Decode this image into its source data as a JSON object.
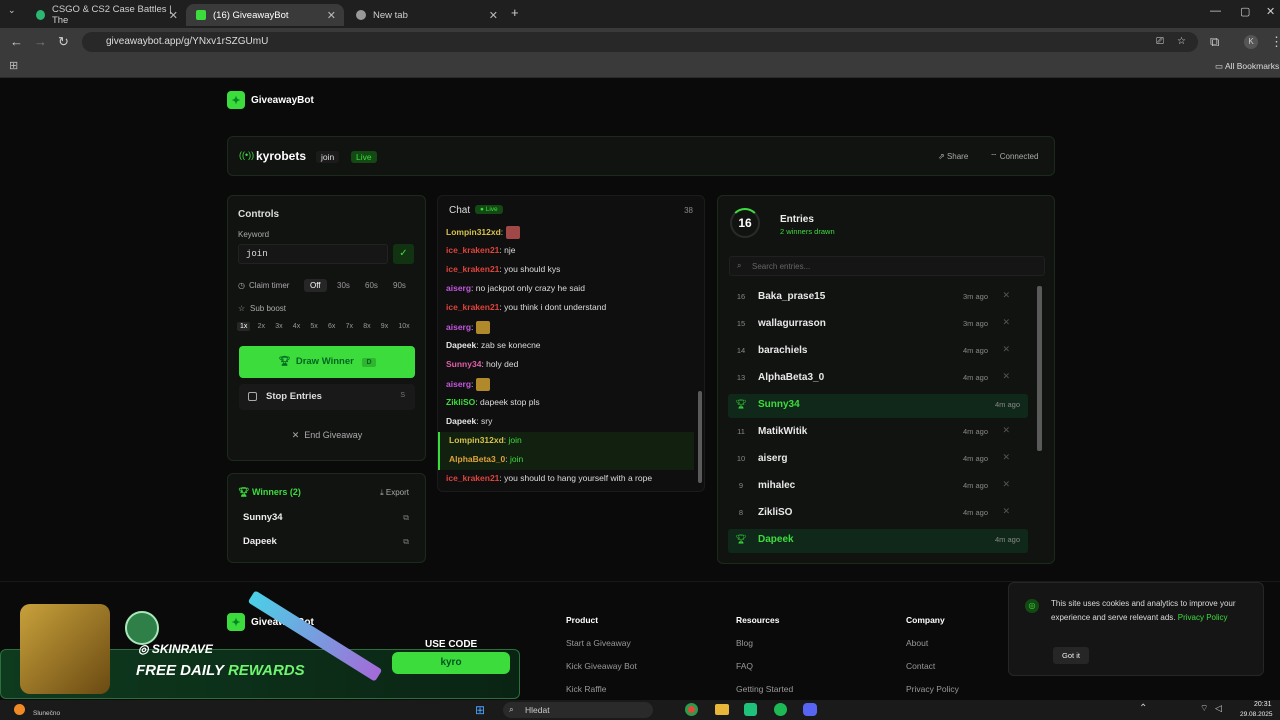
{
  "browser": {
    "tabs": [
      {
        "title": "CSGO & CS2 Case Battles | The"
      },
      {
        "title": "(16) GiveawayBot"
      },
      {
        "title": "New tab"
      }
    ],
    "url": "giveawaybot.app/g/YNxv1rSZGUmU",
    "bookmarks_label": "All Bookmarks",
    "profile_initial": "K"
  },
  "site": {
    "logo": "GiveawayBot"
  },
  "header": {
    "channel": "kyrobets",
    "keyword_badge": "join",
    "live_badge": "Live",
    "share": "Share",
    "connected": "Connected"
  },
  "controls": {
    "title": "Controls",
    "keyword_label": "Keyword",
    "keyword_value": "join",
    "claim_timer_label": "Claim timer",
    "claim_options": [
      "Off",
      "30s",
      "60s",
      "90s"
    ],
    "sub_boost_label": "Sub boost",
    "boost_options": [
      "1x",
      "2x",
      "3x",
      "4x",
      "5x",
      "6x",
      "7x",
      "8x",
      "9x",
      "10x"
    ],
    "draw_button": "Draw Winner",
    "draw_shortcut": "D",
    "stop_entries": "Stop Entries",
    "stop_shortcut": "S",
    "end_giveaway": "End Giveaway"
  },
  "winners": {
    "title": "Winners (2)",
    "export": "Export",
    "list": [
      "Sunny34",
      "Dapeek"
    ]
  },
  "chat": {
    "title": "Chat",
    "live": "Live",
    "count": "38",
    "messages": [
      {
        "user": "Lompin312xd",
        "text": "",
        "color": "#d4c24a",
        "join": false
      },
      {
        "user": "ice_kraken21",
        "text": "nje",
        "color": "#e0443b",
        "join": false
      },
      {
        "user": "ice_kraken21",
        "text": "you should kys",
        "color": "#e0443b",
        "join": false
      },
      {
        "user": "aiserg",
        "text": "no jackpot only crazy he said",
        "color": "#c457e0",
        "join": false
      },
      {
        "user": "ice_kraken21",
        "text": "you think i dont understand",
        "color": "#e0443b",
        "join": false
      },
      {
        "user": "aiserg",
        "text": "",
        "color": "#c457e0",
        "join": false
      },
      {
        "user": "Dapeek",
        "text": "zab se konecne",
        "color": "#e6e6e6",
        "join": false
      },
      {
        "user": "Sunny34",
        "text": "holy ded",
        "color": "#e05fa8",
        "join": false
      },
      {
        "user": "aiserg",
        "text": "",
        "color": "#c457e0",
        "join": false
      },
      {
        "user": "ZikliSO",
        "text": "dapeek stop pls",
        "color": "#3ddc3d",
        "join": false
      },
      {
        "user": "Dapeek",
        "text": "sry",
        "color": "#e6e6e6",
        "join": false
      },
      {
        "user": "Lompin312xd",
        "text": "join",
        "color": "#d4c24a",
        "join": true
      },
      {
        "user": "AlphaBeta3_0",
        "text": "join",
        "color": "#e0a23b",
        "join": true
      },
      {
        "user": "ice_kraken21",
        "text": "you should to hang yourself with a rope",
        "color": "#e0443b",
        "join": false
      }
    ]
  },
  "entries": {
    "count": "16",
    "title": "Entries",
    "subtitle": "2 winners drawn",
    "search_placeholder": "Search entries...",
    "list": [
      {
        "n": "16",
        "name": "Baka_prase15",
        "time": "3m ago",
        "winner": false
      },
      {
        "n": "15",
        "name": "wallagurrason",
        "time": "3m ago",
        "winner": false
      },
      {
        "n": "14",
        "name": "barachiels",
        "time": "4m ago",
        "winner": false
      },
      {
        "n": "13",
        "name": "AlphaBeta3_0",
        "time": "4m ago",
        "winner": false
      },
      {
        "n": "",
        "name": "Sunny34",
        "time": "4m ago",
        "winner": true
      },
      {
        "n": "11",
        "name": "MatikWitik",
        "time": "4m ago",
        "winner": false
      },
      {
        "n": "10",
        "name": "aiserg",
        "time": "4m ago",
        "winner": false
      },
      {
        "n": "9",
        "name": "mihalec",
        "time": "4m ago",
        "winner": false
      },
      {
        "n": "8",
        "name": "ZikliSO",
        "time": "4m ago",
        "winner": false
      },
      {
        "n": "",
        "name": "Dapeek",
        "time": "4m ago",
        "winner": true
      }
    ]
  },
  "footer": {
    "logo": "GiveawayBot",
    "product": {
      "title": "Product",
      "links": [
        "Start a Giveaway",
        "Kick Giveaway Bot",
        "Kick Raffle"
      ]
    },
    "resources": {
      "title": "Resources",
      "links": [
        "Blog",
        "FAQ",
        "Getting Started"
      ]
    },
    "company": {
      "title": "Company",
      "links": [
        "About",
        "Contact",
        "Privacy Policy"
      ]
    }
  },
  "cookie": {
    "text": "This site uses cookies and analytics to improve your experience and serve relevant ads.",
    "link": "Privacy Policy",
    "button": "Got it"
  },
  "ad": {
    "brand": "SKINRAVE",
    "headline_a": "FREE DAILY",
    "headline_b": "REWARDS",
    "use_code": "USE CODE",
    "code": "kyro"
  },
  "taskbar": {
    "weather": "Slunečno",
    "search": "Hledat",
    "time": "20:31",
    "date": "29.08.2025"
  },
  "colors": {
    "accent": "#3ddc3d",
    "bg": "#0a0a0a",
    "panel": "#111311"
  }
}
